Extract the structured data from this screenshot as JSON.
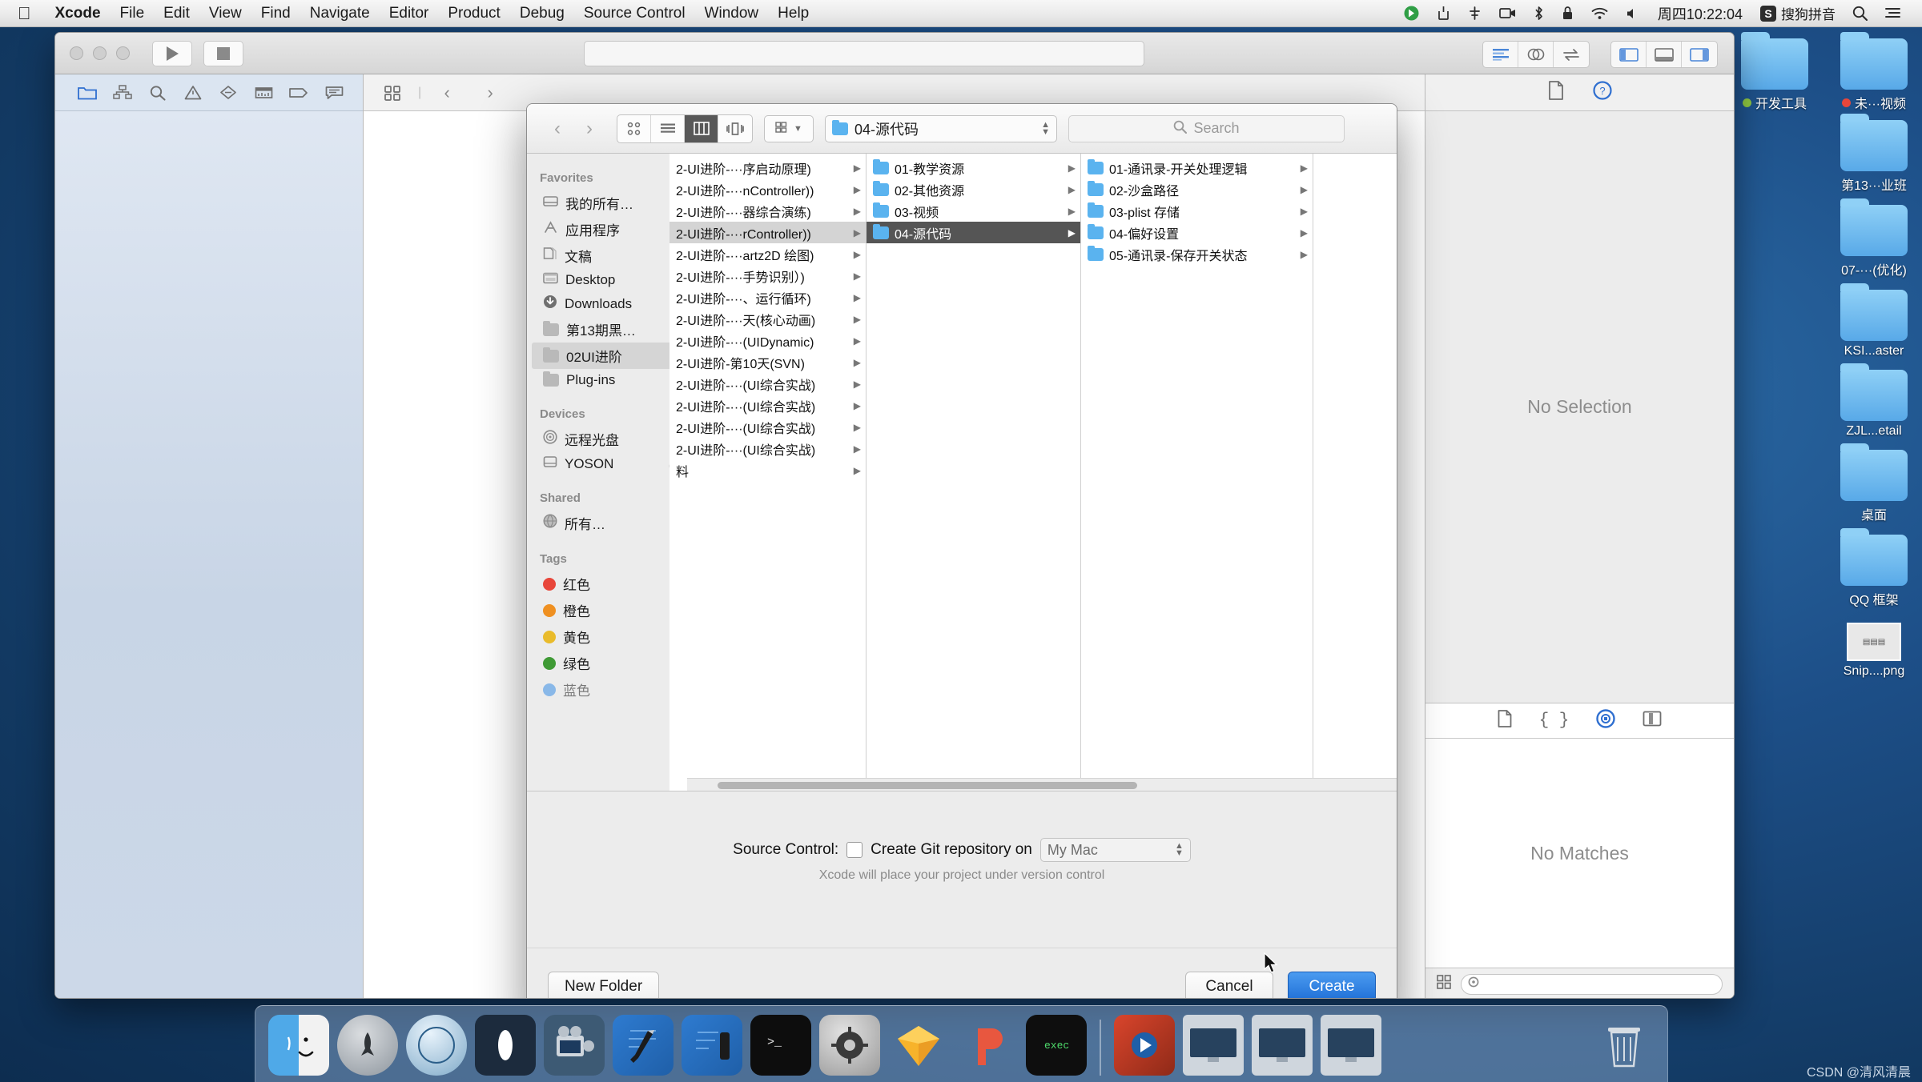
{
  "menubar": {
    "apple_icon": "apple-logo-icon",
    "items": [
      "Xcode",
      "File",
      "Edit",
      "View",
      "Find",
      "Navigate",
      "Editor",
      "Product",
      "Debug",
      "Source Control",
      "Window",
      "Help"
    ],
    "status_icons": [
      "dropbox-icon",
      "eject-icon",
      "bluetooth-sharing-icon",
      "screen-recording-icon",
      "bluetooth-icon",
      "lock-icon",
      "wifi-icon",
      "volume-icon"
    ],
    "clock": "周四10:22:04",
    "ime_badge": "S",
    "ime_label": "搜狗拼音",
    "spotlight_icon": "search-icon",
    "notification_icon": "notification-center-icon"
  },
  "xcode_window": {
    "toolbar": {
      "run_icon": "play-icon",
      "stop_icon": "stop-icon",
      "status_bar_value": "",
      "editor_segments": [
        "standard-editor-icon",
        "assistant-editor-icon",
        "version-editor-icon"
      ],
      "view_segments": [
        "hide-navigator-icon",
        "hide-debug-area-icon",
        "hide-utilities-icon"
      ]
    },
    "navigator": {
      "tabs": [
        "project-navigator-icon",
        "symbol-navigator-icon",
        "find-navigator-icon",
        "issue-navigator-icon",
        "test-navigator-icon",
        "debug-navigator-icon",
        "breakpoint-navigator-icon",
        "report-navigator-icon"
      ]
    },
    "editor": {
      "jump_bar_icons": [
        "related-items-icon",
        "back-chevron-icon",
        "forward-chevron-icon"
      ]
    },
    "inspector": {
      "top_tabs": [
        "file-inspector-icon",
        "quick-help-icon"
      ],
      "top_placeholder": "No Selection",
      "bottom_tabs": [
        "file-template-library-icon",
        "code-snippet-library-icon",
        "object-library-icon",
        "media-library-icon"
      ],
      "bottom_placeholder": "No Matches",
      "filter_icon": "filter-icon",
      "grid_icon": "grid-view-icon",
      "filter_value": ""
    }
  },
  "save_sheet": {
    "toolbar": {
      "back_icon": "back-chevron-icon",
      "forward_icon": "forward-chevron-icon",
      "view_modes": [
        "icon-view-icon",
        "list-view-icon",
        "column-view-icon",
        "coverflow-view-icon"
      ],
      "active_view_mode": "column-view-icon",
      "arrange_icon": "arrange-by-icon",
      "arrange_chevron": "chevron-down-icon",
      "path_popup_label": "04-源代码",
      "path_popup_icon": "folder-icon",
      "stepper_icon": "stepper-icon",
      "search_icon": "search-icon",
      "search_placeholder": "Search",
      "search_value": ""
    },
    "sidebar": {
      "sections": [
        {
          "header": "Favorites",
          "items": [
            {
              "label": "我的所有…",
              "icon": "all-my-files-icon",
              "selected": false
            },
            {
              "label": "应用程序",
              "icon": "applications-icon",
              "selected": false
            },
            {
              "label": "文稿",
              "icon": "documents-icon",
              "selected": false
            },
            {
              "label": "Desktop",
              "icon": "desktop-icon",
              "selected": false
            },
            {
              "label": "Downloads",
              "icon": "downloads-icon",
              "selected": false
            },
            {
              "label": "第13期黑…",
              "icon": "folder-icon",
              "selected": false
            },
            {
              "label": "02UI进阶",
              "icon": "folder-icon",
              "selected": true
            },
            {
              "label": "Plug-ins",
              "icon": "folder-icon",
              "selected": false
            }
          ]
        },
        {
          "header": "Devices",
          "items": [
            {
              "label": "远程光盘",
              "icon": "remote-disc-icon",
              "selected": false
            },
            {
              "label": "YOSON",
              "icon": "hard-disk-icon",
              "selected": false,
              "eject": "⏏"
            }
          ]
        },
        {
          "header": "Shared",
          "items": [
            {
              "label": "所有…",
              "icon": "network-globe-icon",
              "selected": false
            }
          ]
        },
        {
          "header": "Tags",
          "items": [
            {
              "label": "红色",
              "icon": "tag-dot-icon",
              "color": "#e8463a",
              "selected": false
            },
            {
              "label": "橙色",
              "icon": "tag-dot-icon",
              "color": "#ef9021",
              "selected": false
            },
            {
              "label": "黄色",
              "icon": "tag-dot-icon",
              "color": "#e9bb2b",
              "selected": false
            },
            {
              "label": "绿色",
              "icon": "tag-dot-icon",
              "color": "#3f9a35",
              "selected": false
            },
            {
              "label": "蓝色",
              "icon": "tag-dot-icon",
              "color": "#3a8ee6",
              "selected": false
            }
          ]
        }
      ]
    },
    "columns": [
      {
        "name": "column-1",
        "items": [
          {
            "label": "2-UI进阶-···序启动原理)",
            "selected": false
          },
          {
            "label": "2-UI进阶-···nController))",
            "selected": false
          },
          {
            "label": "2-UI进阶-···器综合演练)",
            "selected": false
          },
          {
            "label": "2-UI进阶-···rController))",
            "selected": true
          },
          {
            "label": "2-UI进阶-···artz2D 绘图)",
            "selected": false
          },
          {
            "label": "2-UI进阶-···手势识别）)",
            "selected": false
          },
          {
            "label": "2-UI进阶-···、运行循环)",
            "selected": false
          },
          {
            "label": "2-UI进阶-···天(核心动画)",
            "selected": false
          },
          {
            "label": "2-UI进阶-···(UIDynamic)",
            "selected": false
          },
          {
            "label": "2-UI进阶-第10天(SVN)",
            "selected": false
          },
          {
            "label": "2-UI进阶-···(UI综合实战)",
            "selected": false
          },
          {
            "label": "2-UI进阶-···(UI综合实战)",
            "selected": false
          },
          {
            "label": "2-UI进阶-···(UI综合实战)",
            "selected": false
          },
          {
            "label": "2-UI进阶-···(UI综合实战)",
            "selected": false
          },
          {
            "label": "料",
            "selected": false
          }
        ]
      },
      {
        "name": "column-2",
        "items": [
          {
            "label": "01-教学资源",
            "selected": false
          },
          {
            "label": "02-其他资源",
            "selected": false
          },
          {
            "label": "03-视频",
            "selected": false
          },
          {
            "label": "04-源代码",
            "selected": true
          }
        ]
      },
      {
        "name": "column-3",
        "items": [
          {
            "label": "01-通讯录-开关处理逻辑",
            "selected": false
          },
          {
            "label": "02-沙盒路径",
            "selected": false
          },
          {
            "label": "03-plist 存储",
            "selected": false
          },
          {
            "label": "04-偏好设置",
            "selected": false
          },
          {
            "label": "05-通讯录-保存开关状态",
            "selected": false
          }
        ]
      }
    ],
    "source_control": {
      "label": "Source Control:",
      "checkbox_label": "Create Git repository on",
      "checkbox_checked": false,
      "popup_value": "My Mac",
      "hint": "Xcode will place your project under version control"
    },
    "footer": {
      "new_folder": "New Folder",
      "cancel": "Cancel",
      "create": "Create"
    }
  },
  "desktop": {
    "icons": [
      {
        "label": "开发工具",
        "type": "folder",
        "tag_color": "#8ec641"
      },
      {
        "label": "未···视频",
        "type": "folder",
        "tag_color": "#e8463a"
      },
      {
        "label": "第13···业班",
        "type": "folder"
      },
      {
        "label": "07-···(优化)",
        "type": "folder"
      },
      {
        "label": "KSI...aster",
        "type": "folder"
      },
      {
        "label": "ZJL...etail",
        "type": "folder"
      },
      {
        "label": "桌面",
        "type": "folder"
      },
      {
        "label": "QQ 框架",
        "type": "folder"
      },
      {
        "label": "Snip....png",
        "type": "image"
      }
    ]
  },
  "dock": {
    "items": [
      {
        "name": "finder",
        "running": true,
        "color": "#3b9ae1"
      },
      {
        "name": "launchpad",
        "running": false,
        "color": "#9aa3ab"
      },
      {
        "name": "safari",
        "running": false,
        "color": "#4ea3e0"
      },
      {
        "name": "tower",
        "running": false,
        "color": "#1b2a3b"
      },
      {
        "name": "quicktime",
        "running": true,
        "color": "#4a6a88"
      },
      {
        "name": "xcode",
        "running": true,
        "color": "#2a6fc4"
      },
      {
        "name": "xcode-beta",
        "running": true,
        "color": "#2a6fc4"
      },
      {
        "name": "terminal",
        "running": false,
        "color": "#111111"
      },
      {
        "name": "system-preferences",
        "running": false,
        "color": "#8e8e8e"
      },
      {
        "name": "sketch",
        "running": true,
        "color": "#f5b93c"
      },
      {
        "name": "paw",
        "running": true,
        "color": "#e8573f"
      },
      {
        "name": "exec-app",
        "running": true,
        "color": "#121212"
      },
      {
        "name": "separator",
        "running": false,
        "color": ""
      },
      {
        "name": "media-player",
        "running": false,
        "color": "#c94a2a"
      },
      {
        "name": "display-1",
        "running": false,
        "color": "#cfd6dd"
      },
      {
        "name": "display-2",
        "running": false,
        "color": "#cfd6dd"
      },
      {
        "name": "display-3",
        "running": false,
        "color": "#cfd6dd"
      },
      {
        "name": "trash",
        "running": false,
        "color": "#b9c4cf"
      }
    ]
  },
  "watermark": "CSDN @清风清晨"
}
